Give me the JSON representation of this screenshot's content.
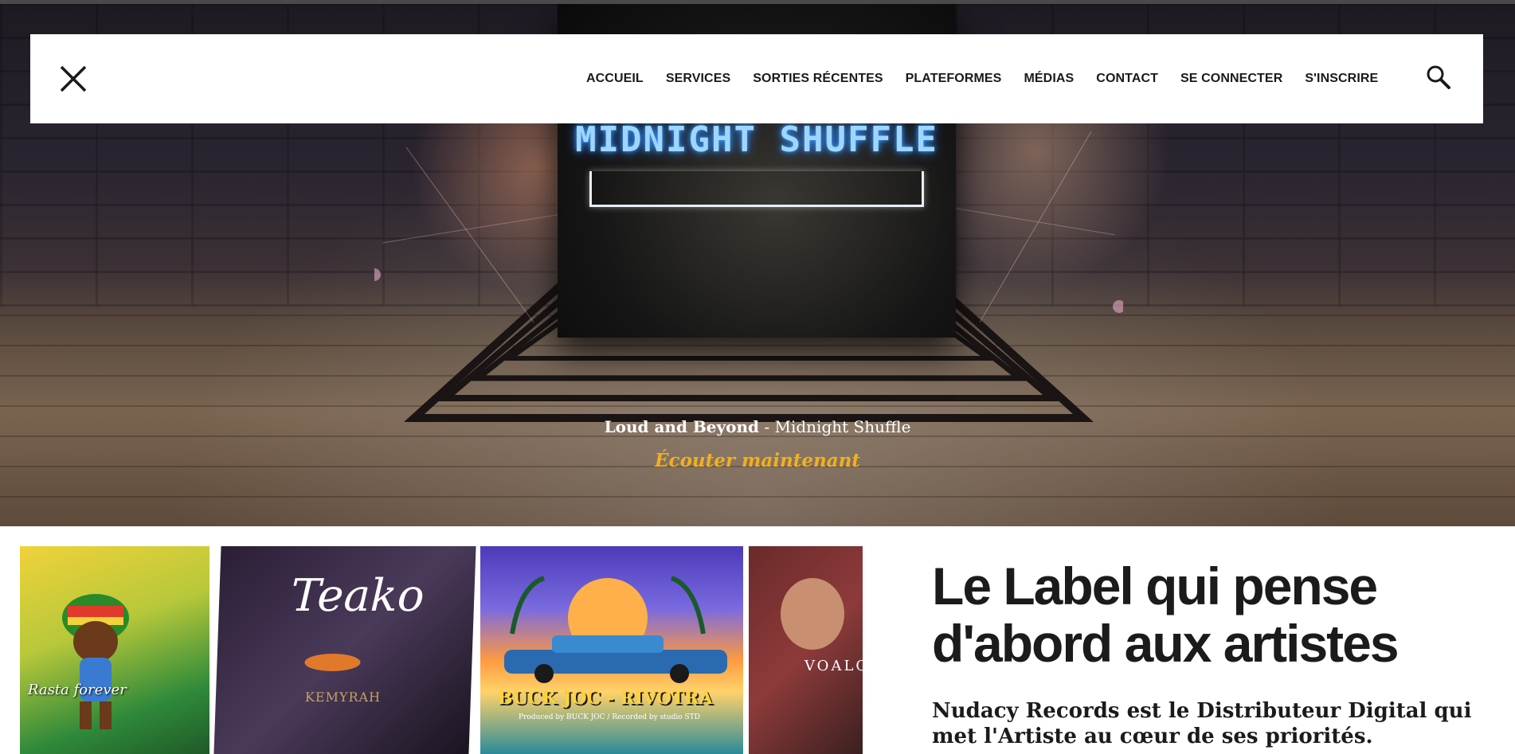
{
  "hero": {
    "album_title": "MIDNIGHT SHUFFLE",
    "artist": "Loud and Beyond",
    "separator": " - ",
    "track": "Midnight Shuffle",
    "cta": "Écouter maintenant"
  },
  "nav": {
    "items": [
      {
        "label": "ACCUEIL"
      },
      {
        "label": "SERVICES"
      },
      {
        "label": "SORTIES RÉCENTES"
      },
      {
        "label": "PLATEFORMES"
      },
      {
        "label": "MÉDIAS"
      },
      {
        "label": "CONTACT"
      },
      {
        "label": "SE CONNECTER"
      },
      {
        "label": "S'INSCRIRE"
      }
    ],
    "close_icon": "close-icon",
    "search_icon": "search-icon"
  },
  "collage": {
    "covers": [
      {
        "name": "rasta-forever",
        "text": "Rasta forever"
      },
      {
        "name": "teako",
        "text": "Teako",
        "subtext": "KEMYRAH"
      },
      {
        "name": "buck-joc-rivotra",
        "text": "BUCK JOC - RIVOTRA",
        "subtext": "Produced by BUCK JOC / Recorded by studio STD"
      },
      {
        "name": "voalo",
        "text": "VOALO"
      }
    ]
  },
  "main": {
    "heading": "Le Label qui pense d'abord aux artistes",
    "subtext": "Nudacy Records est le Distributeur Digital qui met l'Artiste au cœur de ses priorités."
  },
  "colors": {
    "cta": "#f2b01e",
    "neon": "#9fd6ff",
    "text": "#1b1b1b"
  }
}
